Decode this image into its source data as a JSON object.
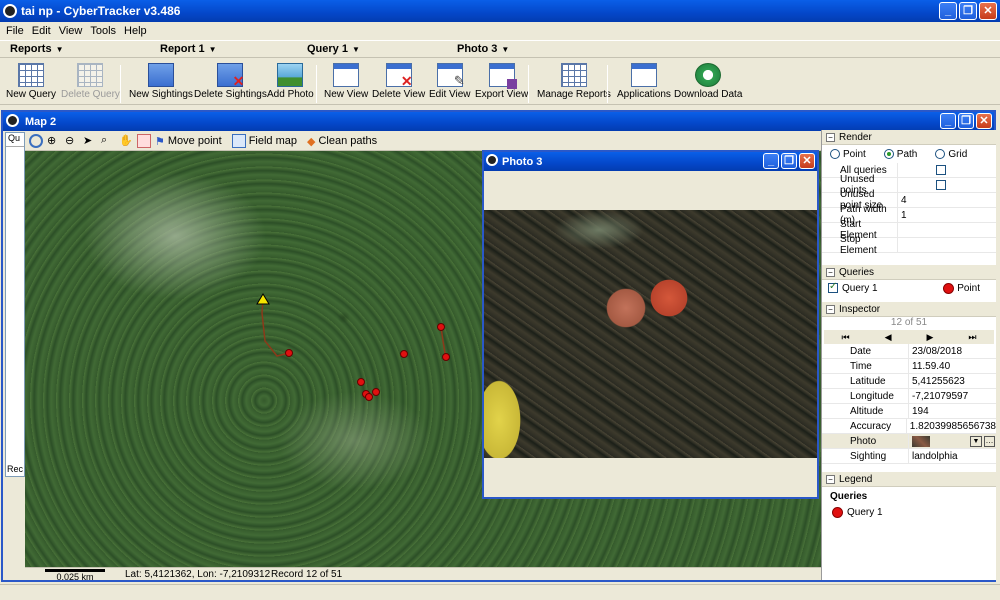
{
  "app": {
    "title": "tai np - CyberTracker v3.486"
  },
  "menu": [
    "File",
    "Edit",
    "View",
    "Tools",
    "Help"
  ],
  "selectors": {
    "reports": "Reports",
    "report": "Report 1",
    "query": "Query 1",
    "photo": "Photo 3"
  },
  "toolbar": {
    "new_query": "New Query",
    "delete_query": "Delete Query",
    "new_sightings": "New Sightings",
    "delete_sightings": "Delete Sightings",
    "add_photo": "Add Photo",
    "new_view": "New View",
    "delete_view": "Delete View",
    "edit_view": "Edit View",
    "export_view": "Export View",
    "manage_reports": "Manage Reports",
    "applications": "Applications",
    "download_data": "Download Data"
  },
  "map": {
    "title": "Map 2",
    "tools": {
      "move_point": "Move point",
      "field_map": "Field map",
      "clean_paths": "Clean paths"
    },
    "left_tab": "Qu",
    "left_record": "Rec",
    "scale": "0.025 km",
    "coords": "Lat: 5,4121362, Lon: -7,2109312",
    "record": "Record 12 of 51"
  },
  "photo_window": {
    "title": "Photo 3"
  },
  "render": {
    "header": "Render",
    "modes": {
      "point": "Point",
      "path": "Path",
      "grid": "Grid"
    },
    "selected_mode": "Path",
    "props": {
      "all_queries": "All queries",
      "unused_points": "Unused points",
      "unused_point_size": "Unused point size",
      "unused_point_size_val": "4",
      "path_width": "Path width (m)",
      "path_width_val": "1",
      "start_element": "Start Element",
      "stop_element": "Stop Element"
    }
  },
  "queries": {
    "header": "Queries",
    "item": "Query 1",
    "style": "Point"
  },
  "inspector": {
    "header": "Inspector",
    "pager": "12 of 51",
    "rows": {
      "date_k": "Date",
      "date_v": "23/08/2018",
      "time_k": "Time",
      "time_v": "11.59.40",
      "lat_k": "Latitude",
      "lat_v": "5,41255623",
      "lon_k": "Longitude",
      "lon_v": "-7,21079597",
      "alt_k": "Altitude",
      "alt_v": "194",
      "acc_k": "Accuracy",
      "acc_v": "1.82039985656738",
      "photo_k": "Photo",
      "sighting_k": "Sighting",
      "sighting_v": "landolphia"
    }
  },
  "legend": {
    "header": "Legend",
    "sub": "Queries",
    "item": "Query 1"
  },
  "colors": {
    "point": "#e01010",
    "path": "#8b3a1a",
    "titlebar": "#0447c9"
  }
}
